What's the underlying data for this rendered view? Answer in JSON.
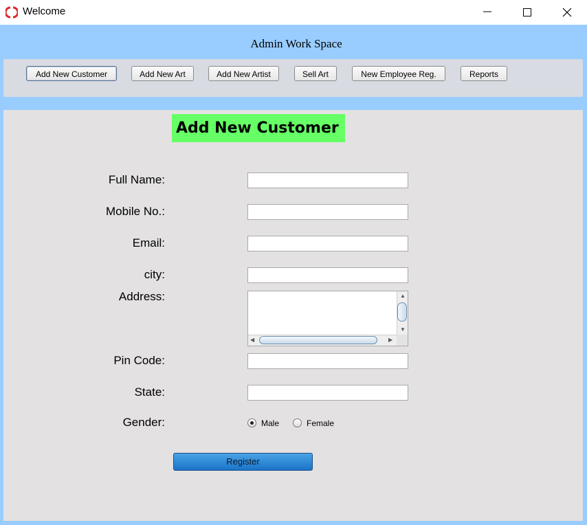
{
  "window": {
    "title": "Welcome"
  },
  "header": {
    "title": "Admin Work Space"
  },
  "toolbar": {
    "buttons": [
      {
        "label": "Add New Customer"
      },
      {
        "label": "Add New Art"
      },
      {
        "label": "Add New Artist"
      },
      {
        "label": "Sell Art"
      },
      {
        "label": "New Employee Reg."
      },
      {
        "label": "Reports"
      }
    ]
  },
  "form": {
    "heading": "Add New Customer",
    "fields": {
      "full_name": {
        "label": "Full Name:",
        "value": ""
      },
      "mobile": {
        "label": "Mobile No.:",
        "value": ""
      },
      "email": {
        "label": "Email:",
        "value": ""
      },
      "city": {
        "label": "city:",
        "value": ""
      },
      "address": {
        "label": "Address:",
        "value": ""
      },
      "pin_code": {
        "label": "Pin Code:",
        "value": ""
      },
      "state": {
        "label": "State:",
        "value": ""
      }
    },
    "gender": {
      "label": "Gender:",
      "options": [
        "Male",
        "Female"
      ],
      "selected": "Male"
    },
    "register_label": "Register"
  },
  "colors": {
    "background": "#99ccff",
    "toolbar": "#d8dbe2",
    "panel": "#e3e1e2",
    "heading_bg": "#66ff66",
    "register_bg": "#1a73c8"
  }
}
